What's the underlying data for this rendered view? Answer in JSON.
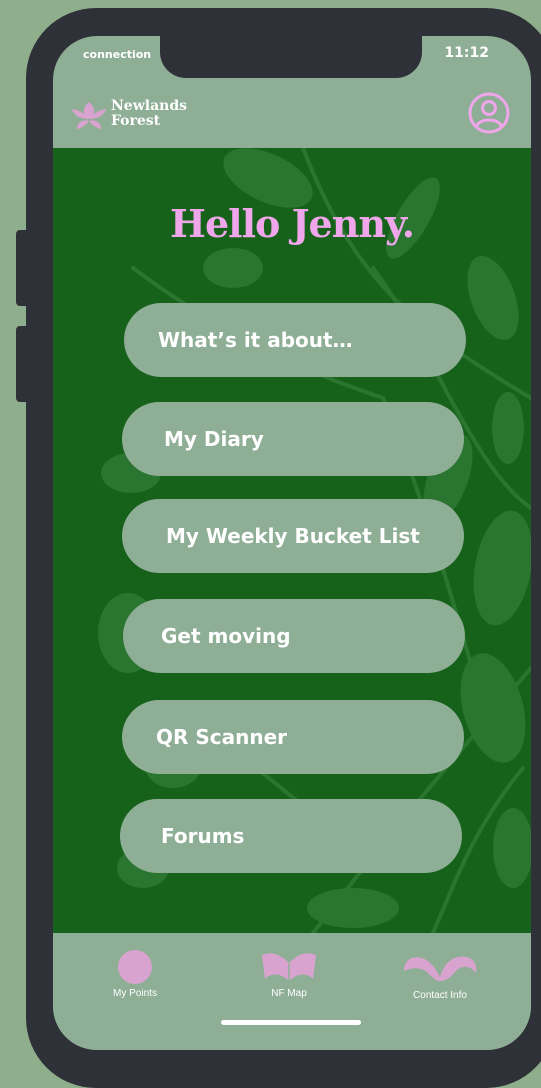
{
  "status_bar": {
    "network": "connection",
    "time": "11:12"
  },
  "header": {
    "brand_line1": "Newlands",
    "brand_line2": "Forest",
    "logo_icon": "lotus-icon",
    "profile_icon": "user-circle-icon"
  },
  "main": {
    "greeting": "Hello Jenny.",
    "menu": [
      {
        "label": "What’s it about…"
      },
      {
        "label": "My Diary"
      },
      {
        "label": "My Weekly Bucket List"
      },
      {
        "label": "Get moving"
      },
      {
        "label": "QR Scanner"
      },
      {
        "label": "Forums"
      }
    ]
  },
  "tabbar": {
    "tabs": [
      {
        "label": "My Points",
        "icon": "circle-points-icon"
      },
      {
        "label": "NF Map",
        "icon": "map-icon"
      },
      {
        "label": "Contact Info",
        "icon": "contact-icon"
      }
    ]
  },
  "colors": {
    "background": "#8fae8c",
    "panel": "#8fae96",
    "forest_green": "#17621b",
    "accent_pink": "#f0a6ea",
    "icon_pink": "#d9a3d0",
    "phone_frame": "#2f3138"
  }
}
